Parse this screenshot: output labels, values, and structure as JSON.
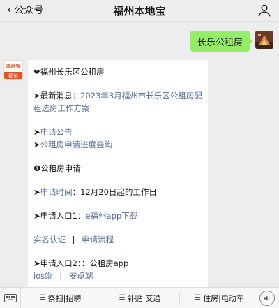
{
  "header": {
    "back_label": "公众号",
    "title": "福州本地宝"
  },
  "outgoing": {
    "text": "长乐公租房"
  },
  "account_avatar": {
    "top": "本地宝",
    "bottom": "福州"
  },
  "message": {
    "heading": "❤福州长乐区公租房",
    "news_prefix": "➤最新消息：",
    "news_link": "2023年3月福州市长乐区公租房配租选房工作方案",
    "apply_notice_arrow": "➤",
    "apply_notice": "申请公告",
    "progress_arrow": "➤",
    "progress_query": "公租房申请进度查询",
    "section_title": "❶公租房申请",
    "time_arrow": "➤",
    "time_label": "申请时间",
    "time_value": "：12月20日起的工作日",
    "entry1_prefix": "➤申请入口1：",
    "entry1_link": "e福州app下载",
    "realname": "实名认证",
    "separator": "|",
    "process": "申请流程",
    "entry2_prefix": "➤申请入口2：：公租房app",
    "ios": "ios端",
    "separator2": "|",
    "android": "安卓端"
  },
  "bottom_menu": {
    "items": [
      {
        "label": "祭扫|招聘"
      },
      {
        "label": "补贴|交通"
      },
      {
        "label": "住房|电动车"
      }
    ]
  },
  "icons": {
    "back": "chevron-left-icon",
    "profile": "person-icon",
    "keyboard": "keyboard-icon",
    "menu": "hamburger-icon",
    "sound": "sound-icon"
  }
}
